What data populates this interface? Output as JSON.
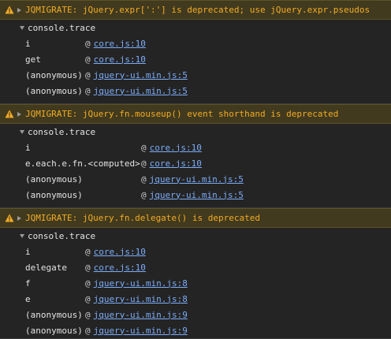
{
  "groups": [
    {
      "warning": "JQMIGRATE: jQuery.expr[':'] is deprecated; use jQuery.expr.pseudos",
      "trace_label": "console.trace",
      "frames": [
        {
          "fn": "i",
          "at": "@",
          "link": "core.js:10"
        },
        {
          "fn": "get",
          "at": "@",
          "link": "core.js:10"
        },
        {
          "fn": "(anonymous)",
          "at": "@",
          "link": "jquery-ui.min.js:5"
        },
        {
          "fn": "(anonymous)",
          "at": "@",
          "link": "jquery-ui.min.js:5"
        }
      ]
    },
    {
      "warning": "JQMIGRATE: jQuery.fn.mouseup() event shorthand is deprecated",
      "trace_label": "console.trace",
      "frames": [
        {
          "fn": "i",
          "at": "@",
          "link": "core.js:10"
        },
        {
          "fn": "e.each.e.fn.<computed>",
          "at": "@",
          "link": "core.js:10"
        },
        {
          "fn": "(anonymous)",
          "at": "@",
          "link": "jquery-ui.min.js:5"
        },
        {
          "fn": "(anonymous)",
          "at": "@",
          "link": "jquery-ui.min.js:5"
        }
      ]
    },
    {
      "warning": "JQMIGRATE: jQuery.fn.delegate() is deprecated",
      "trace_label": "console.trace",
      "frames": [
        {
          "fn": "i",
          "at": "@",
          "link": "core.js:10"
        },
        {
          "fn": "delegate",
          "at": "@",
          "link": "core.js:10"
        },
        {
          "fn": "f",
          "at": "@",
          "link": "jquery-ui.min.js:8"
        },
        {
          "fn": "e",
          "at": "@",
          "link": "jquery-ui.min.js:8"
        },
        {
          "fn": "(anonymous)",
          "at": "@",
          "link": "jquery-ui.min.js:9"
        },
        {
          "fn": "(anonymous)",
          "at": "@",
          "link": "jquery-ui.min.js:9"
        }
      ]
    }
  ],
  "colors": {
    "background": "#242424",
    "warning_bg": "#413a1e",
    "warning_text": "#f2ab26",
    "link": "#7cacf8"
  },
  "icons": {
    "warning": "warning-triangle-icon",
    "expand": "disclosure-triangle-icon"
  }
}
